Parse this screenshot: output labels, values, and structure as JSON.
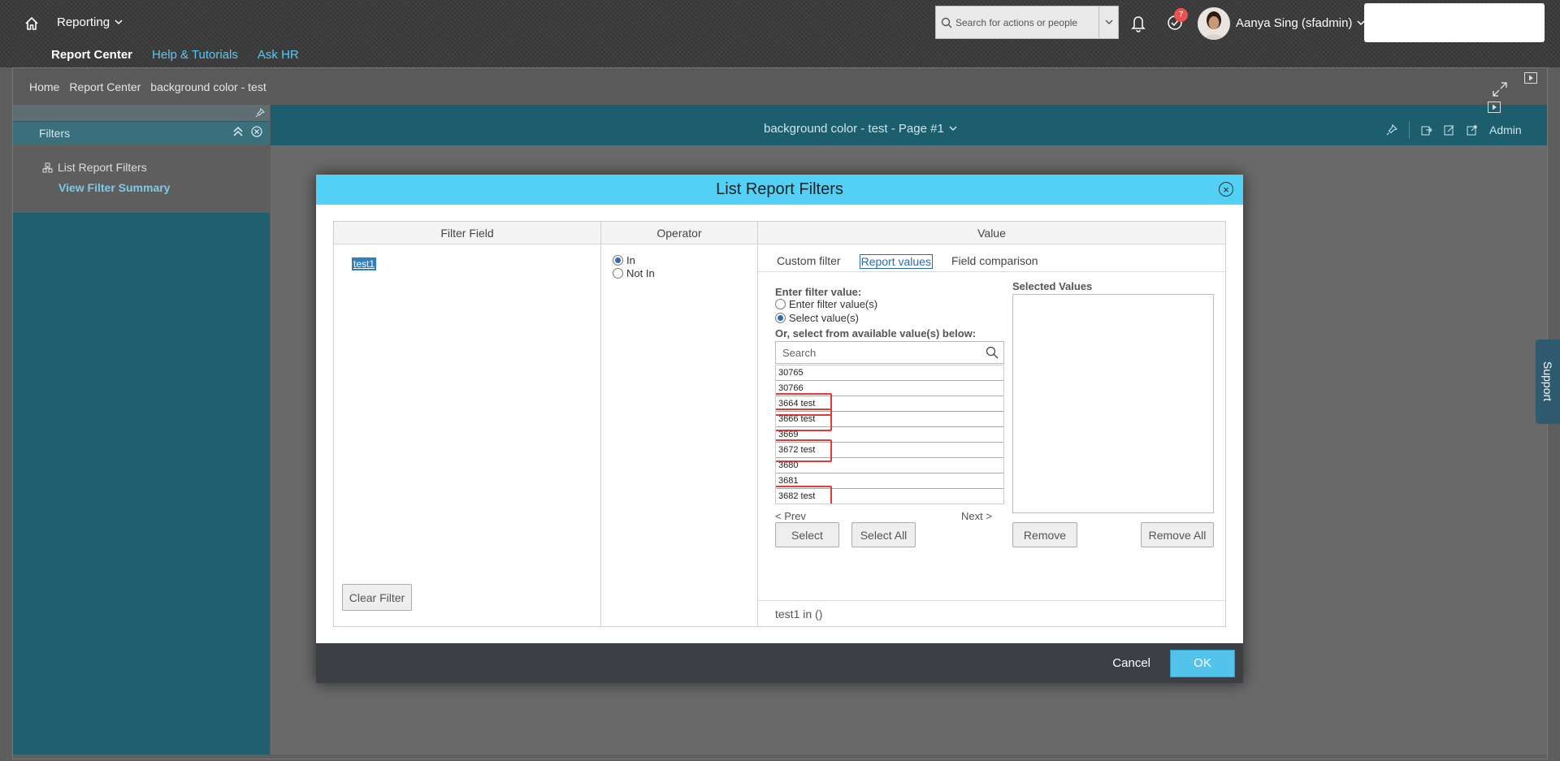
{
  "shell": {
    "app_title": "Reporting",
    "search_placeholder": "Search for actions or people",
    "notification_count": "7",
    "user_name": "Aanya Sing (sfadmin)",
    "subnav": [
      {
        "label": "Report Center"
      },
      {
        "label": "Help & Tutorials"
      },
      {
        "label": "Ask HR"
      }
    ]
  },
  "breadcrumb": [
    "Home",
    "Report Center",
    "background color - test"
  ],
  "left_panel": {
    "title": "Filters",
    "list_report_filters": "List Report Filters",
    "view_filter_summary": "View Filter Summary"
  },
  "report": {
    "page_title": "background color - test - Page #1",
    "admin_label": "Admin"
  },
  "support_label": "Support",
  "dialog": {
    "title": "List Report Filters",
    "columns": {
      "filter_field": "Filter Field",
      "operator": "Operator",
      "value": "Value"
    },
    "selected_field": "test1",
    "clear_filter": "Clear Filter",
    "operators": [
      {
        "label": "In",
        "selected": true
      },
      {
        "label": "Not In",
        "selected": false
      }
    ],
    "tabs": [
      {
        "label": "Custom filter",
        "active": false
      },
      {
        "label": "Report values",
        "active": true
      },
      {
        "label": "Field comparison",
        "active": false
      }
    ],
    "enter_filter_value_label": "Enter filter value:",
    "mode_options": [
      {
        "label": "Enter filter value(s)",
        "selected": false
      },
      {
        "label": "Select value(s)",
        "selected": true
      }
    ],
    "available_label": "Or, select from available value(s) below:",
    "search_placeholder": "Search",
    "values": [
      {
        "label": "30765",
        "highlighted": false
      },
      {
        "label": "30766",
        "highlighted": false
      },
      {
        "label": "3664 test",
        "highlighted": true
      },
      {
        "label": "3666 test",
        "highlighted": true
      },
      {
        "label": "3669",
        "highlighted": false
      },
      {
        "label": "3672 test",
        "highlighted": true
      },
      {
        "label": "3680",
        "highlighted": false
      },
      {
        "label": "3681",
        "highlighted": false
      },
      {
        "label": "3682 test",
        "highlighted": true
      }
    ],
    "prev": "< Prev",
    "next": "Next >",
    "select_btn": "Select",
    "select_all_btn": "Select All",
    "selected_values_label": "Selected Values",
    "remove_btn": "Remove",
    "remove_all_btn": "Remove All",
    "expression": "test1 in ()",
    "cancel": "Cancel",
    "ok": "OK"
  },
  "colors": {
    "dialog_header": "#52d0f5",
    "teal_panel": "#1e5e6e",
    "highlight_box": "#e03a3a",
    "link_blue": "#5cc8f0"
  }
}
